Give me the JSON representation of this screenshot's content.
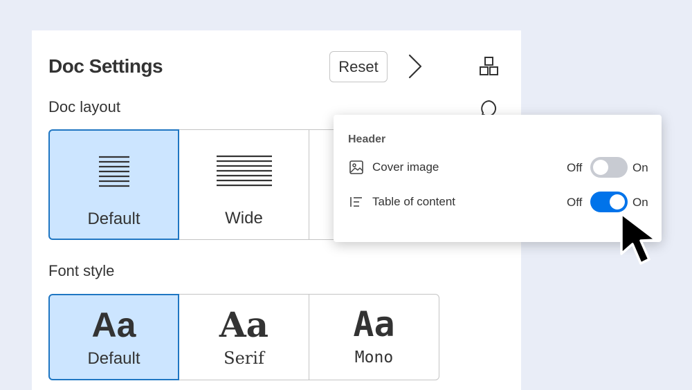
{
  "panel": {
    "title": "Doc Settings",
    "reset_label": "Reset",
    "doc_layout_label": "Doc layout",
    "font_style_label": "Font style"
  },
  "layout_options": [
    {
      "label": "Default",
      "selected": true
    },
    {
      "label": "Wide",
      "selected": false
    },
    {
      "label": "",
      "selected": false
    }
  ],
  "font_options": [
    {
      "sample": "Aa",
      "label": "Default",
      "selected": true
    },
    {
      "sample": "Aa",
      "label": "Serif",
      "selected": false
    },
    {
      "sample": "Aa",
      "label": "Mono",
      "selected": false
    }
  ],
  "popup": {
    "header": "Header",
    "rows": [
      {
        "label": "Cover image",
        "off": "Off",
        "on": "On",
        "state": "off",
        "icon": "image-icon"
      },
      {
        "label": "Table of content",
        "off": "Off",
        "on": "On",
        "state": "on",
        "icon": "toc-icon"
      }
    ]
  },
  "colors": {
    "accent": "#0073ea",
    "selected_bg": "#cce5ff",
    "selected_border": "#1f76c2",
    "background": "#e9edf7"
  },
  "icons": [
    "chevron-right-icon",
    "apps-icon",
    "comment-icon",
    "cursor-icon"
  ]
}
